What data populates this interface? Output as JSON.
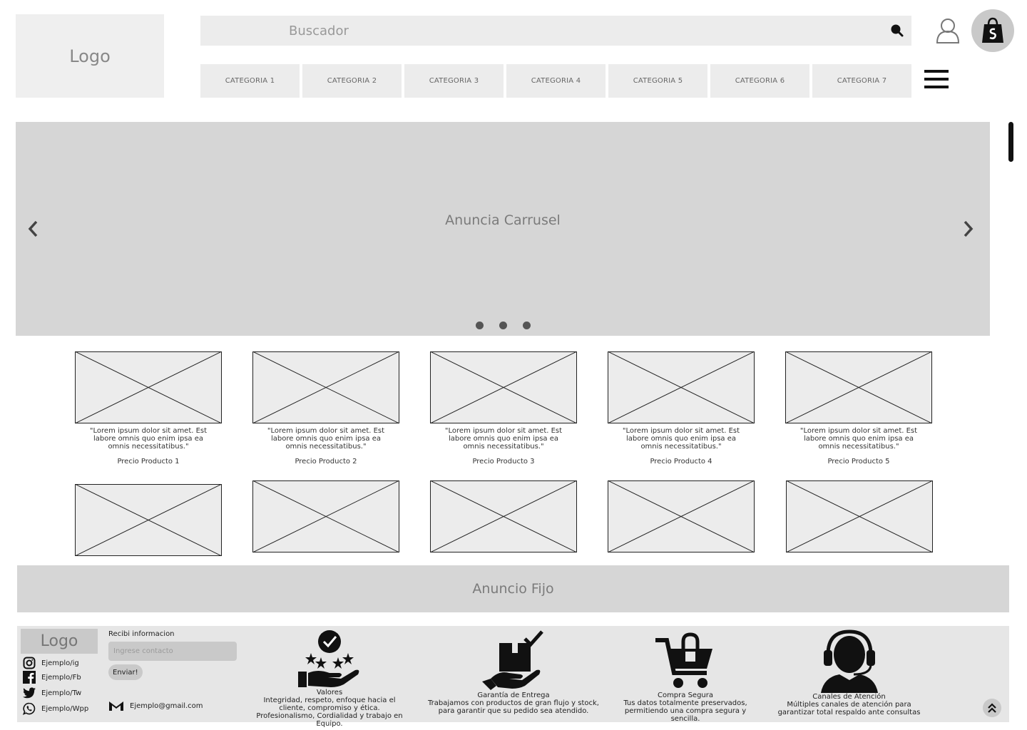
{
  "header": {
    "logo": "Logo",
    "search_placeholder": "Buscador",
    "categories": [
      "CATEGORIA 1",
      "CATEGORIA 2",
      "CATEGORIA 3",
      "CATEGORIA 4",
      "CATEGORIA 5",
      "CATEGORIA 6",
      "CATEGORIA 7"
    ]
  },
  "carousel": {
    "label": "Anuncia Carrusel",
    "dots": 3
  },
  "products": [
    {
      "desc": "\"Lorem ipsum dolor sit amet. Est labore omnis quo enim ipsa ea omnis necessitatibus.\"",
      "price": "Precio Producto 1"
    },
    {
      "desc": "\"Lorem ipsum dolor sit amet. Est labore omnis quo enim ipsa ea omnis necessitatibus.\"",
      "price": "Precio Producto 2"
    },
    {
      "desc": "\"Lorem ipsum dolor sit amet. Est labore omnis quo enim ipsa ea omnis necessitatibus.\"",
      "price": "Precio Producto 3"
    },
    {
      "desc": "\"Lorem ipsum dolor sit amet. Est labore omnis quo enim ipsa ea omnis necessitatibus.\"",
      "price": "Precio Producto 4"
    },
    {
      "desc": "\"Lorem ipsum dolor sit amet. Est labore omnis quo enim ipsa ea omnis necessitatibus.\"",
      "price": "Precio Producto 5"
    }
  ],
  "fixed_ad": "Anuncio Fijo",
  "footer": {
    "logo": "Logo",
    "social": {
      "instagram": "Ejemplo/ig",
      "facebook": "Ejemplo/Fb",
      "twitter": "Ejemplo/Tw",
      "whatsapp": "Ejemplo/Wpp"
    },
    "newsletter_title": "Recibi informacion",
    "newsletter_placeholder": "Ingrese contacto",
    "send_label": "Enviar!",
    "email": "Ejemplo@gmail.com",
    "features": [
      {
        "icon": "values-hand-icon",
        "title": "Valores",
        "text": "Integridad, respeto, enfoque hacia el cliente, compromiso y ética. Profesionalismo, Cordialidad y trabajo en Equipo."
      },
      {
        "icon": "delivery-box-icon",
        "title": "Garantía de Entrega",
        "text": "Trabajamos con productos de gran flujo y stock, para garantir que su pedido sea atendido."
      },
      {
        "icon": "secure-cart-icon",
        "title": "Compra Segura",
        "text": "Tus datos totalmente preservados, permitiendo una compra segura y sencilla."
      },
      {
        "icon": "headset-support-icon",
        "title": "Canales de Atención",
        "text": "Múltiples canales de atención para garantizar total respaldo ante consultas"
      }
    ]
  },
  "colors": {
    "placeholder_gray": "#ececec",
    "banner_gray": "#d6d6d6",
    "footer_gray": "#e6e6e6"
  }
}
